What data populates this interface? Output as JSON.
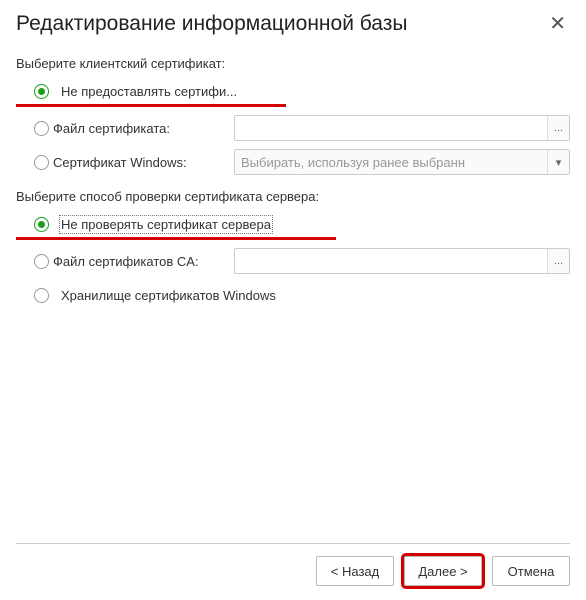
{
  "header": {
    "title": "Редактирование информационной базы"
  },
  "client_cert": {
    "label": "Выберите клиентский сертификат:",
    "opt_none": "Не предоставлять сертифи...",
    "opt_file": "Файл сертификата:",
    "opt_windows": "Сертификат Windows:",
    "windows_placeholder": "Выбирать, используя ранее выбранн"
  },
  "server_cert": {
    "label": "Выберите способ проверки сертификата сервера:",
    "opt_none": "Не проверять сертификат сервера",
    "opt_ca_file": "Файл сертификатов CA:",
    "opt_windows_store": "Хранилище сертификатов Windows"
  },
  "buttons": {
    "back": "< Назад",
    "next": "Далее >",
    "cancel": "Отмена"
  },
  "icons": {
    "ellipsis": "...",
    "dropdown": "▾"
  }
}
